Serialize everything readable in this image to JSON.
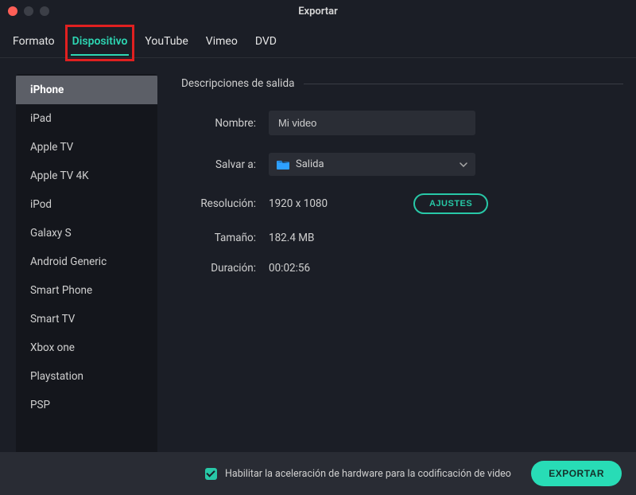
{
  "window": {
    "title": "Exportar"
  },
  "tabs": [
    {
      "label": "Formato",
      "active": false
    },
    {
      "label": "Dispositivo",
      "active": true,
      "highlighted": true
    },
    {
      "label": "YouTube",
      "active": false
    },
    {
      "label": "Vimeo",
      "active": false
    },
    {
      "label": "DVD",
      "active": false
    }
  ],
  "sidebar": {
    "items": [
      {
        "label": "iPhone",
        "selected": true
      },
      {
        "label": "iPad"
      },
      {
        "label": "Apple TV"
      },
      {
        "label": "Apple TV 4K"
      },
      {
        "label": "iPod"
      },
      {
        "label": "Galaxy S"
      },
      {
        "label": "Android Generic"
      },
      {
        "label": "Smart Phone"
      },
      {
        "label": "Smart TV"
      },
      {
        "label": "Xbox one"
      },
      {
        "label": "Playstation"
      },
      {
        "label": "PSP"
      }
    ]
  },
  "panel": {
    "section_title": "Descripciones de salida",
    "labels": {
      "name": "Nombre:",
      "save_to": "Salvar a:",
      "resolution": "Resolución:",
      "size": "Tamaño:",
      "duration": "Duración:"
    },
    "values": {
      "name": "Mi video",
      "save_to": "Salida",
      "resolution": "1920 x 1080",
      "size": "182.4 MB",
      "duration": "00:02:56"
    },
    "settings_button": "AJUSTES"
  },
  "footer": {
    "hw_accel_label": "Habilitar la aceleración de hardware para la codificación de video",
    "hw_accel_checked": true,
    "export_button": "EXPORTAR"
  },
  "colors": {
    "accent": "#28c8a7",
    "bg": "#1b1e26",
    "sidebar_bg": "#14161c",
    "input_bg": "#2a2d35",
    "footer_bg": "#292c34"
  }
}
